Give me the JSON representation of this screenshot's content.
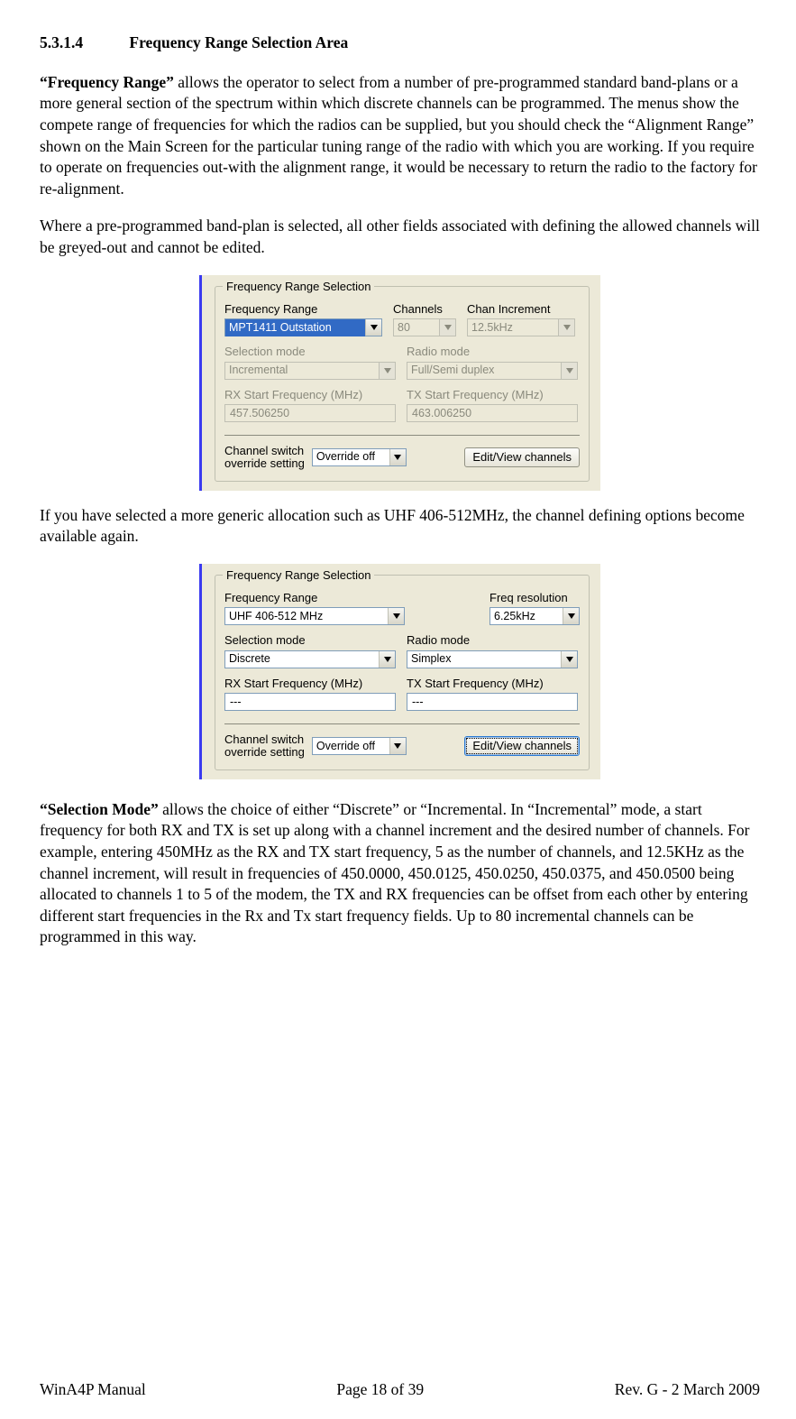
{
  "section": {
    "number": "5.3.1.4",
    "title": "Frequency Range Selection Area"
  },
  "para1_lead": "“Frequency Range”",
  "para1_rest": " allows the operator to select from a number of pre-programmed standard band-plans or a more general section of the spectrum within which discrete channels can be programmed.  The menus show the compete range of frequencies for which the radios can be supplied, but you should check the “Alignment Range” shown on the Main Screen for the particular tuning range of the radio with which you are working.  If you require to operate on frequencies out-with the alignment range, it would be necessary to return the radio to the factory for re-alignment.",
  "para2": "Where a pre-programmed band-plan is selected, all other fields associated with defining the allowed channels will be greyed-out and cannot be edited.",
  "para3": "If you have selected a more generic allocation such as UHF 406-512MHz,  the channel defining options become available again.",
  "para4_lead": "“Selection Mode”",
  "para4_rest": " allows the choice of either “Discrete” or “Incremental.  In “Incremental” mode, a start frequency for both RX and TX is set up along with a channel increment and the desired number of channels.  For example, entering 450MHz as the RX and TX start frequency, 5 as the number of channels, and 12.5KHz as the channel increment, will result in frequencies of 450.0000, 450.0125, 450.0250, 450.0375, and 450.0500 being allocated to channels 1 to 5 of the modem, the TX and RX frequencies can be offset from each other by entering different start frequencies in the Rx and Tx start frequency fields.   Up to 80 incremental channels can be programmed in this way.",
  "fig_shared": {
    "group_title": "Frequency Range Selection",
    "labels": {
      "freq_range": "Frequency Range",
      "channels": "Channels",
      "chan_inc": "Chan Increment",
      "freq_res": "Freq resolution",
      "sel_mode": "Selection mode",
      "radio_mode": "Radio mode",
      "rx_start": "RX Start Frequency (MHz)",
      "tx_start": "TX Start Frequency (MHz)",
      "chan_sw1": "Channel switch",
      "chan_sw2": "override setting",
      "edit_btn": "Edit/View channels"
    }
  },
  "fig1": {
    "freq_range": "MPT1411 Outstation",
    "channels": "80",
    "chan_inc": "12.5kHz",
    "sel_mode": "Incremental",
    "radio_mode": "Full/Semi duplex",
    "rx_start": "457.506250",
    "tx_start": "463.006250",
    "override": "Override off"
  },
  "fig2": {
    "freq_range": "UHF 406-512 MHz",
    "freq_res": "6.25kHz",
    "sel_mode": "Discrete",
    "radio_mode": "Simplex",
    "rx_start": "---",
    "tx_start": "---",
    "override": "Override off"
  },
  "footer": {
    "left": "WinA4P Manual",
    "center": "Page 18 of 39",
    "right": "Rev. G -  2 March 2009"
  }
}
